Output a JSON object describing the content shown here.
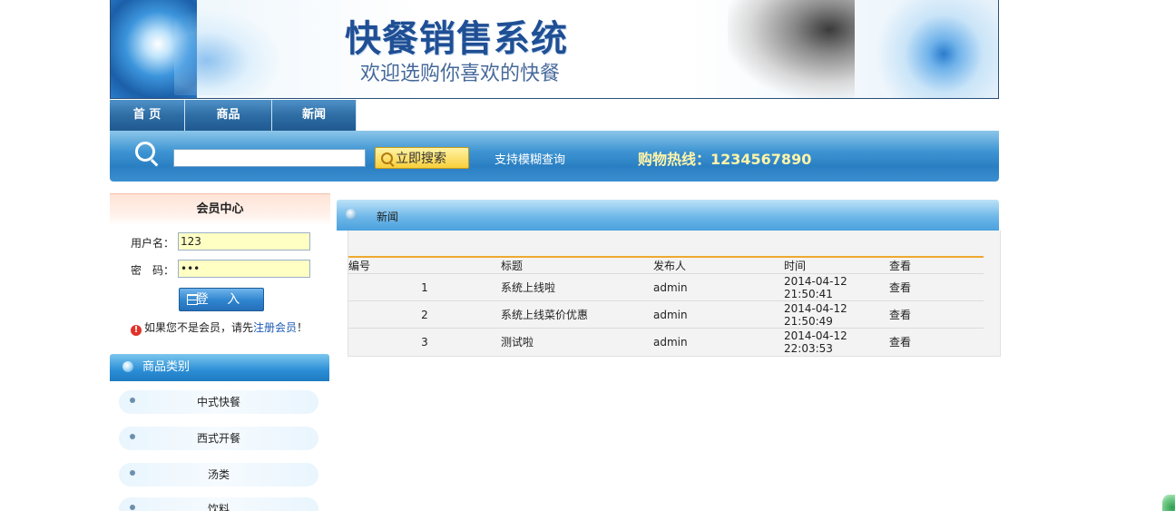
{
  "banner": {
    "title": "快餐销售系统",
    "subtitle": "欢迎选购你喜欢的快餐"
  },
  "nav": {
    "tabs": [
      {
        "label": "首 页"
      },
      {
        "label": "商品"
      },
      {
        "label": "新闻"
      }
    ]
  },
  "search": {
    "value": "",
    "button_label": "立即搜索",
    "hint": "支持模糊查询",
    "hotline": "购物热线：1234567890"
  },
  "member": {
    "title": "会员中心",
    "username_label": "用户名：",
    "username_value": "123",
    "password_label": "密　码：",
    "password_value": "•••",
    "login_label": "登 入",
    "notice_prefix": "如果您不是会员，请先",
    "register_link": "注册会员",
    "notice_suffix": "！"
  },
  "categories": {
    "title": "商品类别",
    "items": [
      {
        "label": "中式快餐"
      },
      {
        "label": "西式开餐"
      },
      {
        "label": "汤类"
      },
      {
        "label": "饮料"
      }
    ]
  },
  "news": {
    "title": "新闻",
    "columns": [
      "编号",
      "标题",
      "发布人",
      "时间",
      "查看"
    ],
    "rows": [
      {
        "id": "1",
        "title": "系统上线啦",
        "author": "admin",
        "time": "2014-04-12 21:50:41",
        "view": "查看"
      },
      {
        "id": "2",
        "title": "系统上线菜价优惠",
        "author": "admin",
        "time": "2014-04-12 21:50:49",
        "view": "查看"
      },
      {
        "id": "3",
        "title": "测试啦",
        "author": "admin",
        "time": "2014-04-12 22:03:53",
        "view": "查看"
      }
    ]
  },
  "colors": {
    "nav_blue": "#2e6da5",
    "search_band": "#3f95d3",
    "title_blue": "#1f4f94",
    "hotline_yellow": "#fff4a8",
    "input_yellow": "#ffffc4",
    "divider_orange": "#f0a830"
  }
}
